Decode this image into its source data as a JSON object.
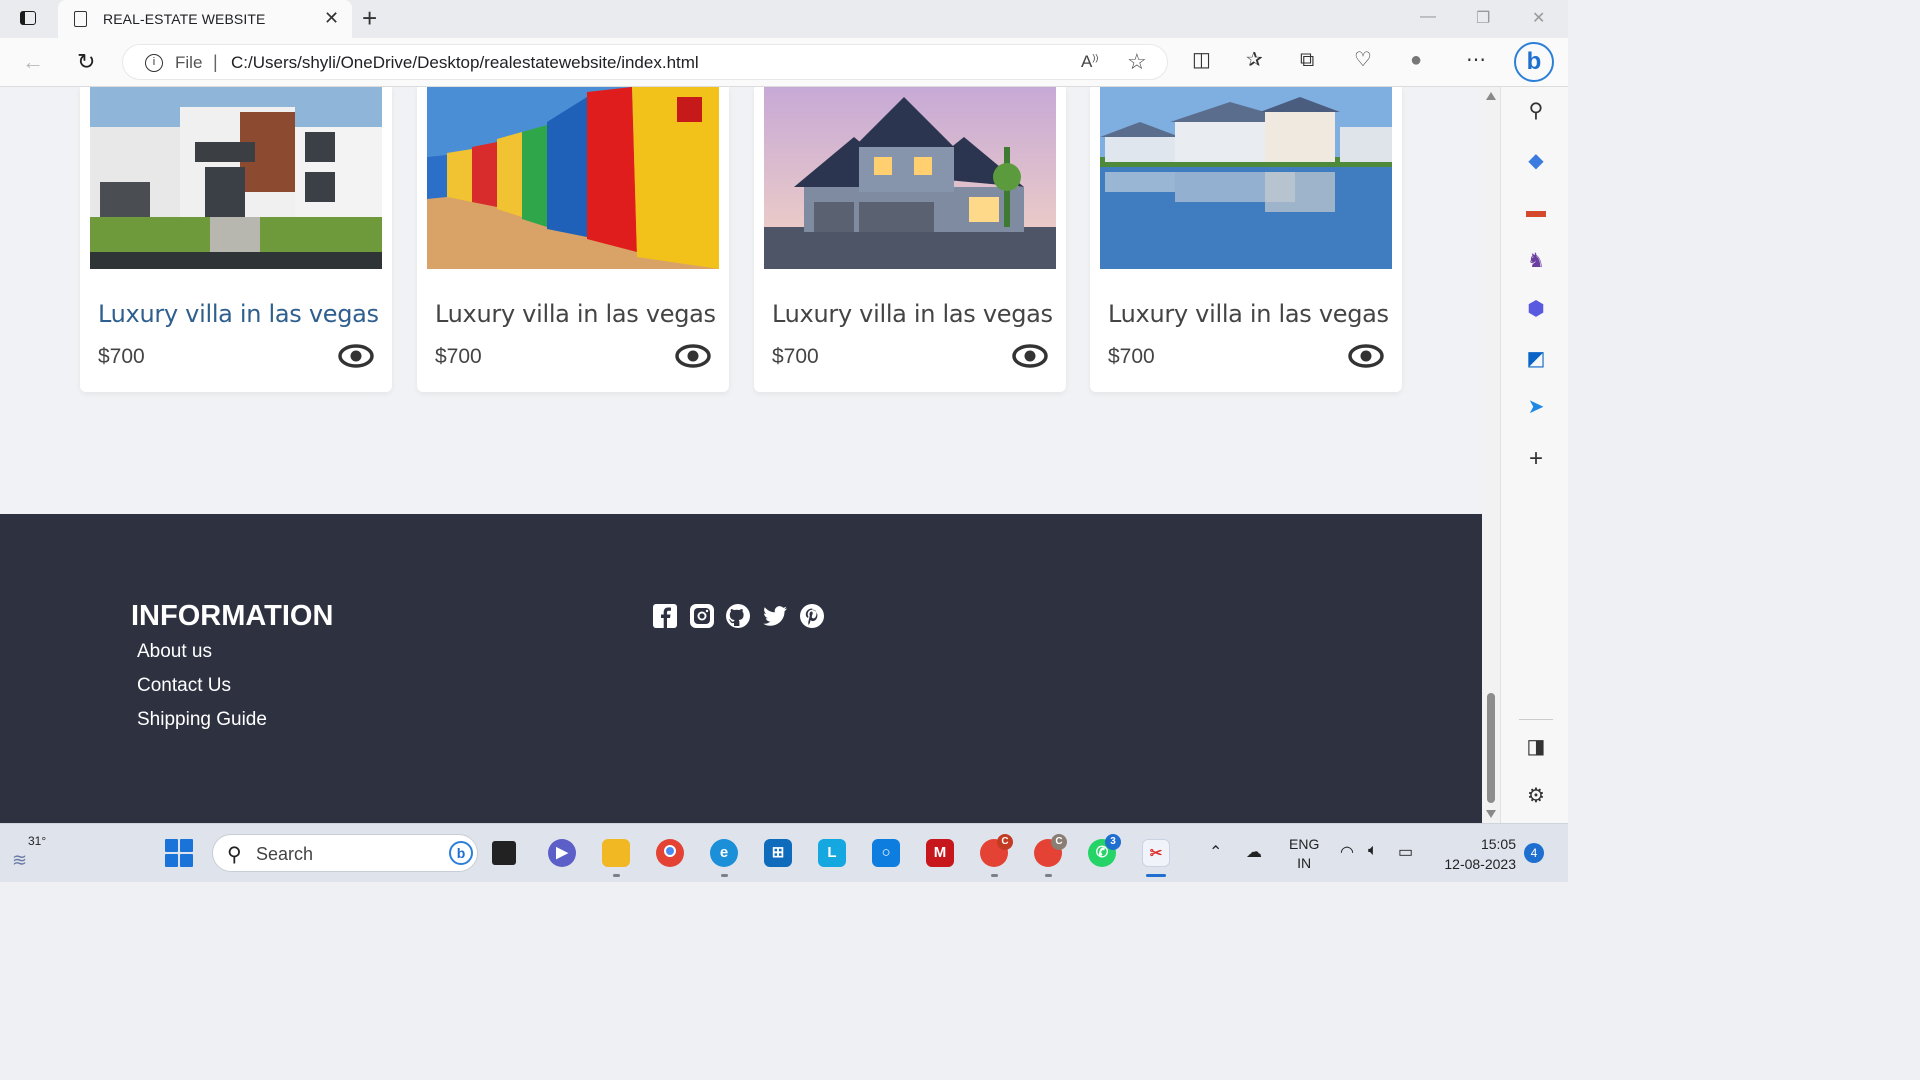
{
  "browser": {
    "tab_title": "REAL-ESTATE WEBSITE",
    "address_scheme": "File",
    "address_url": "C:/Users/shyli/OneDrive/Desktop/realestatewebsite/index.html"
  },
  "listings": [
    {
      "title": "Luxury villa in las vegas",
      "price": "$700",
      "image": "modern-villa"
    },
    {
      "title": "Luxury villa in las vegas",
      "price": "$700",
      "image": "colorful-beach-huts"
    },
    {
      "title": "Luxury villa in las vegas",
      "price": "$700",
      "image": "suburban-house-dusk"
    },
    {
      "title": "Luxury villa in las vegas",
      "price": "$700",
      "image": "waterfront-houses"
    }
  ],
  "footer": {
    "heading": "INFORMATION",
    "links": [
      "About us",
      "Contact Us",
      "Shipping Guide"
    ],
    "social_icons": [
      "facebook-icon",
      "instagram-icon",
      "github-icon",
      "twitter-icon",
      "pinterest-icon"
    ]
  },
  "taskbar": {
    "temperature": "31°",
    "search_placeholder": "Search",
    "language": "ENG",
    "region": "IN",
    "time": "15:05",
    "date": "12-08-2023",
    "notification_count": "4",
    "whatsapp_badge": "3"
  },
  "colors": {
    "footer_bg": "#2e3140",
    "link_hover": "#2f5f8e",
    "page_bg": "#f0f2f5"
  }
}
